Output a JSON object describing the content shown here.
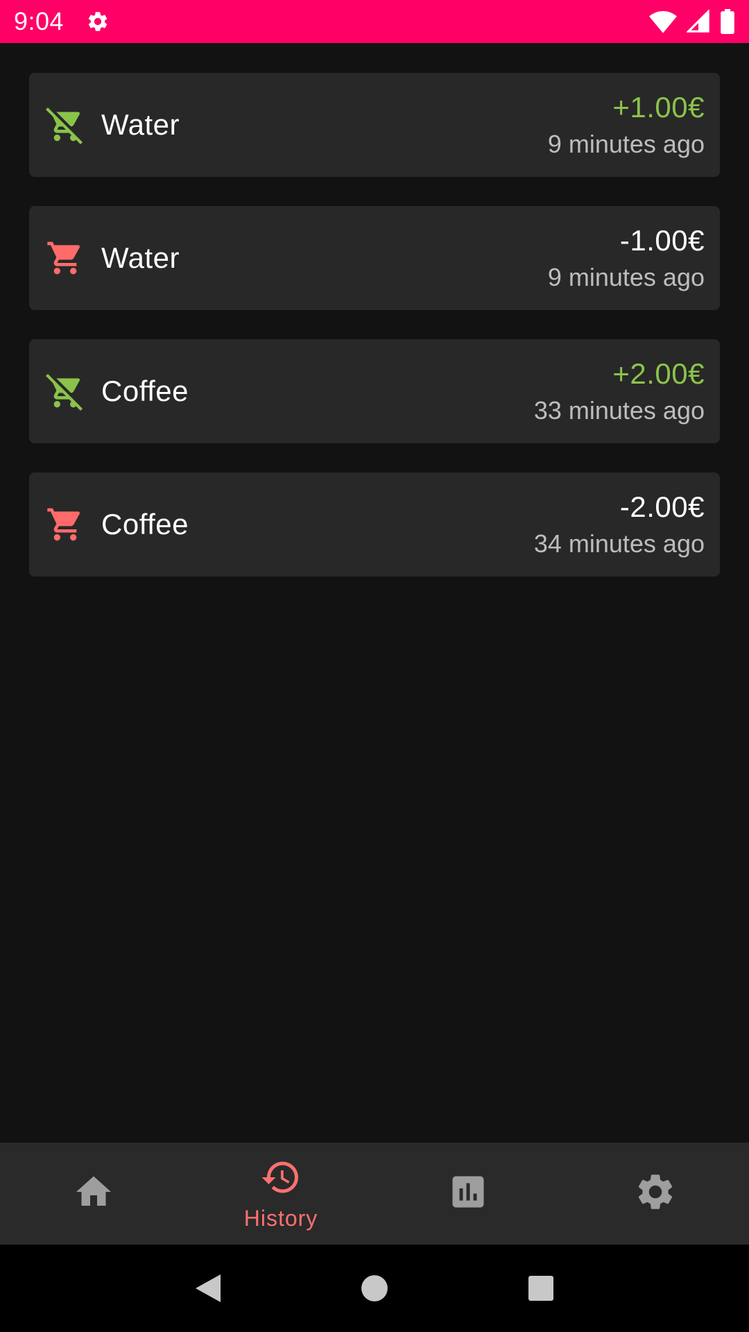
{
  "status_bar": {
    "time": "9:04",
    "background": "#ff0066",
    "icons": [
      "settings-icon",
      "wifi-icon",
      "cellular-signal-icon",
      "battery-icon"
    ]
  },
  "colors": {
    "income": "#8bc34a",
    "expense": "#ff6b6b",
    "card_bg": "#282828",
    "page_bg": "#121212",
    "nav_bg": "#2a2a2a",
    "nav_active": "#ff7070",
    "nav_inactive": "#9e9e9e"
  },
  "history": {
    "items": [
      {
        "name": "Water",
        "amount": "+1.00€",
        "time": "9 minutes ago",
        "type": "income",
        "icon": "remove-shopping-cart-icon"
      },
      {
        "name": "Water",
        "amount": "-1.00€",
        "time": "9 minutes ago",
        "type": "expense",
        "icon": "shopping-cart-icon"
      },
      {
        "name": "Coffee",
        "amount": "+2.00€",
        "time": "33 minutes ago",
        "type": "income",
        "icon": "remove-shopping-cart-icon"
      },
      {
        "name": "Coffee",
        "amount": "-2.00€",
        "time": "34 minutes ago",
        "type": "expense",
        "icon": "shopping-cart-icon"
      }
    ]
  },
  "bottom_nav": {
    "items": [
      {
        "id": "home",
        "icon": "home-icon",
        "label": "",
        "active": false
      },
      {
        "id": "history",
        "icon": "history-icon",
        "label": "History",
        "active": true
      },
      {
        "id": "stats",
        "icon": "bar-chart-icon",
        "label": "",
        "active": false
      },
      {
        "id": "settings",
        "icon": "settings-icon",
        "label": "",
        "active": false
      }
    ]
  },
  "system_nav": {
    "icons": [
      "back-icon",
      "home-circle-icon",
      "recents-icon"
    ]
  }
}
